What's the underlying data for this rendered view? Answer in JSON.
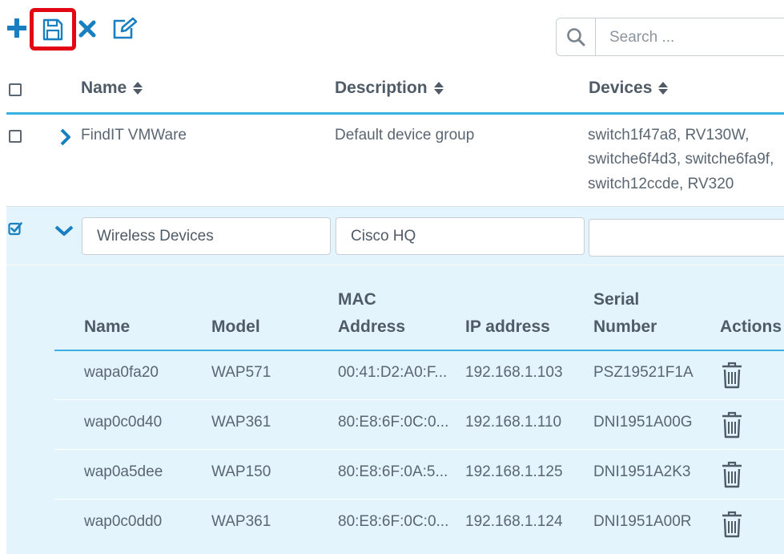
{
  "toolbar": {
    "add_icon": "plus-icon",
    "save_icon": "floppy-disk-icon",
    "delete_icon": "close-icon",
    "edit_icon": "edit-icon",
    "accent_color": "#1a7fc0",
    "highlight_color": "#e30613"
  },
  "search": {
    "placeholder": "Search ..."
  },
  "table": {
    "headers": {
      "name": "Name",
      "description": "Description",
      "devices": "Devices"
    }
  },
  "groups": [
    {
      "name": "FindIT VMWare",
      "description": "Default device group",
      "devices_lines": [
        "switch1f47a8, RV130W,",
        "switche6f4d3, switche6fa9f,",
        "switch12ccde, RV320"
      ],
      "checked": false,
      "expanded": false
    },
    {
      "name": "Wireless Devices",
      "description": "Cisco HQ",
      "devices": "",
      "checked": true,
      "expanded": true
    }
  ],
  "devices_table": {
    "headers": {
      "name": "Name",
      "model": "Model",
      "mac_line1": "MAC",
      "mac_line2": "Address",
      "ip": "IP address",
      "serial_line1": "Serial",
      "serial_line2": "Number",
      "actions": "Actions"
    },
    "rows": [
      {
        "name": "wapa0fa20",
        "model": "WAP571",
        "mac": "00:41:D2:A0:F...",
        "ip": "192.168.1.103",
        "serial": "PSZ19521F1A"
      },
      {
        "name": "wap0c0d40",
        "model": "WAP361",
        "mac": "80:E8:6F:0C:0...",
        "ip": "192.168.1.110",
        "serial": "DNI1951A00G"
      },
      {
        "name": "wap0a5dee",
        "model": "WAP150",
        "mac": "80:E8:6F:0A:5...",
        "ip": "192.168.1.125",
        "serial": "DNI1951A2K3"
      },
      {
        "name": "wap0c0dd0",
        "model": "WAP361",
        "mac": "80:E8:6F:0C:0...",
        "ip": "192.168.1.124",
        "serial": "DNI1951A00R"
      }
    ],
    "action_icon": "trash-icon"
  }
}
